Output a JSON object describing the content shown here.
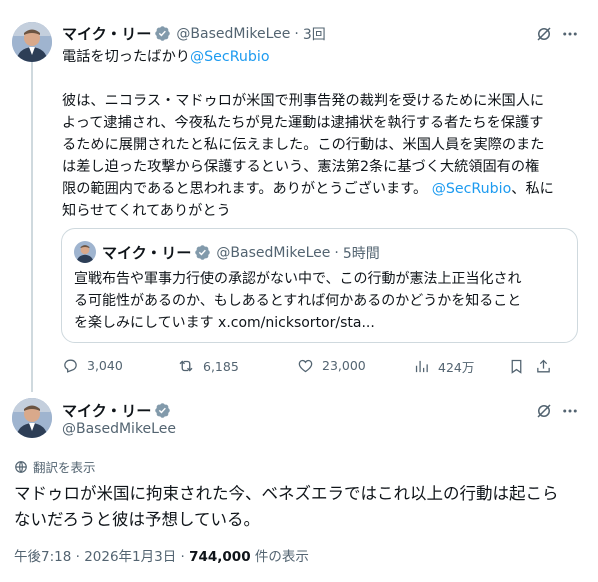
{
  "reply_tweet": {
    "author_name": "マイク・リー",
    "author_handle": "@BasedMikeLee",
    "separator": "·",
    "time": "3回",
    "line1_text": "電話を切ったばかり",
    "line1_mention": "@SecRubio",
    "paragraph_lines": [
      "彼は、ニコラス・マドゥロが米国で刑事告発の裁判を受けるために米国人に",
      "よって逮捕され、今夜私たちが見た運動は逮捕状を執行する者たちを保護す",
      "るために展開されたと私に伝えました。この行動は、米国人員を実際のまた",
      "は差し迫った攻撃から保護するという、憲法第2条に基づく大統領固有の権",
      "限の範囲内であると思われます。ありがとうございます。"
    ],
    "paragraph_mention": "@SecRubio",
    "paragraph_tail": "、私に",
    "paragraph_last_line": "知らせてくれてありがとう",
    "quote": {
      "author_name": "マイク・リー",
      "author_handle": "@BasedMikeLee",
      "separator": "·",
      "time": "5時間",
      "lines": [
        "宣戦布告や軍事力行使の承認がない中で、この行動が憲法上正当化され",
        "る可能性があるのか、もしあるとすれば何かあるのかどうかを知ること",
        "を楽しみにしています x.com/nicksortor/sta..."
      ]
    },
    "metrics": {
      "replies": "3,040",
      "reposts": "6,185",
      "likes": "23,000",
      "views": "424万"
    }
  },
  "main_tweet": {
    "author_name": "マイク・リー",
    "author_handle": "@BasedMikeLee",
    "translate_label": "翻訳を表示",
    "text_lines": [
      "マドゥロが米国に拘束された今、ベネズエラではこれ以上の行動は起こら",
      "ないだろうと彼は予想している。"
    ],
    "timestamp": "午後7:18 · 2026年1月3日 ·",
    "view_count": "744,000",
    "view_suffix": "件の表示"
  },
  "colors": {
    "accent": "#1d9bf0",
    "verified": "#829aab",
    "muted": "#536471",
    "border": "#cfd9de"
  },
  "icons": [
    "grok-icon",
    "more-icon",
    "verified-badge-icon",
    "reply-icon",
    "repost-icon",
    "like-icon",
    "views-icon",
    "bookmark-icon",
    "share-icon",
    "translate-icon"
  ]
}
